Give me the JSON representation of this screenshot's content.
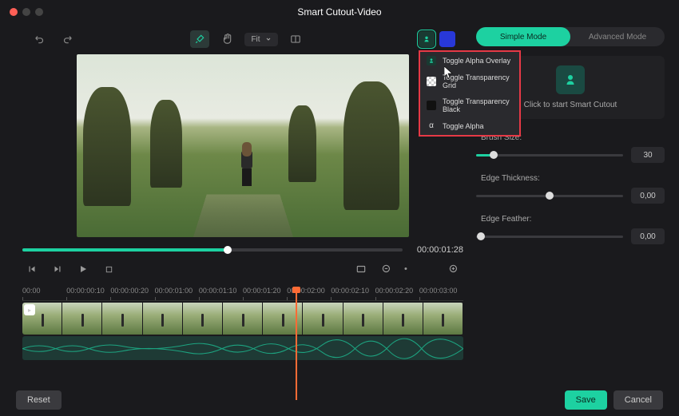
{
  "title": "Smart Cutout-Video",
  "toolbar": {
    "fit": "Fit"
  },
  "swatches": [
    {
      "color": "#1dd1a1",
      "head": "#0a3a30"
    },
    {
      "color": "#2838d8"
    }
  ],
  "dropdown": [
    {
      "label": "Toggle Alpha Overlay",
      "ico": "#1dd1a1"
    },
    {
      "label": "Toggle Transparency Grid",
      "ico": "#e8e8e8"
    },
    {
      "label": "Toggle Transparency Black",
      "ico": "#111"
    },
    {
      "label": "Toggle Alpha",
      "ico": "α"
    }
  ],
  "progress": {
    "time": "00:00:01:28"
  },
  "ruler": [
    "00:00",
    "00:00:00:10",
    "00:00:00:20",
    "00:00:01:00",
    "00:00:01:10",
    "00:00:01:20",
    "00:00:02:00",
    "00:00:02:10",
    "00:00:02:20",
    "00:00:03:00"
  ],
  "modes": {
    "simple": "Simple Mode",
    "advanced": "Advanced Mode"
  },
  "cutout": {
    "label": "Click to start Smart Cutout"
  },
  "params": {
    "brush": {
      "label": "Brush Size:",
      "val": "30",
      "pct": 12
    },
    "edge": {
      "label": "Edge Thickness:",
      "val": "0,00",
      "pct": 50
    },
    "feather": {
      "label": "Edge Feather:",
      "val": "0,00",
      "pct": 3
    }
  },
  "footer": {
    "reset": "Reset",
    "save": "Save",
    "cancel": "Cancel"
  }
}
